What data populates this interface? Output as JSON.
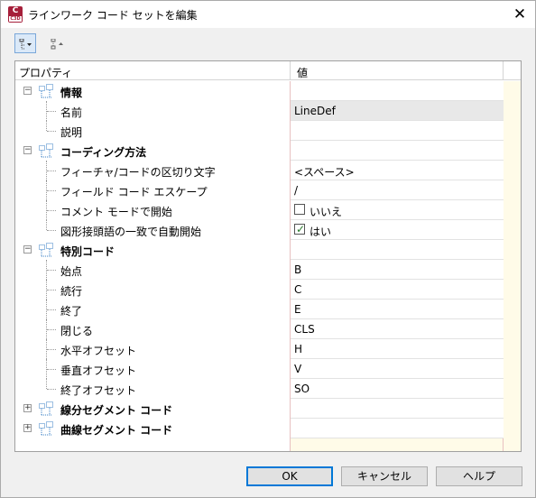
{
  "window": {
    "title": "ラインワーク コード セットを編集",
    "app_icon_letter": "C",
    "app_icon_sub": "C3D",
    "close_glyph": "✕"
  },
  "toolbar": {
    "categorized_icon": "categorized-view-icon",
    "alphabetical_icon": "alphabetical-sort-icon"
  },
  "grid": {
    "header_property": "プロパティ",
    "header_value": "値",
    "sections": [
      {
        "label": "情報",
        "expanded": true,
        "items": [
          {
            "label": "名前",
            "value": "LineDef",
            "selected": true
          },
          {
            "label": "説明",
            "value": ""
          }
        ]
      },
      {
        "label": "コーディング方法",
        "expanded": true,
        "items": [
          {
            "label": "フィーチャ/コードの区切り文字",
            "value": "<スペース>"
          },
          {
            "label": "フィールド コード エスケープ",
            "value": "/"
          },
          {
            "label": "コメント モードで開始",
            "value": "いいえ",
            "checkbox": true,
            "checked": false
          },
          {
            "label": "図形接頭語の一致で自動開始",
            "value": "はい",
            "checkbox": true,
            "checked": true
          }
        ]
      },
      {
        "label": "特別コード",
        "expanded": true,
        "items": [
          {
            "label": "始点",
            "value": "B"
          },
          {
            "label": "続行",
            "value": "C"
          },
          {
            "label": "終了",
            "value": "E"
          },
          {
            "label": "閉じる",
            "value": "CLS"
          },
          {
            "label": "水平オフセット",
            "value": "H"
          },
          {
            "label": "垂直オフセット",
            "value": "V"
          },
          {
            "label": "終了オフセット",
            "value": "SO"
          }
        ]
      },
      {
        "label": "線分セグメント コード",
        "expanded": false,
        "items": []
      },
      {
        "label": "曲線セグメント コード",
        "expanded": false,
        "items": []
      }
    ]
  },
  "buttons": {
    "ok": "OK",
    "cancel": "キャンセル",
    "help": "ヘルプ"
  }
}
